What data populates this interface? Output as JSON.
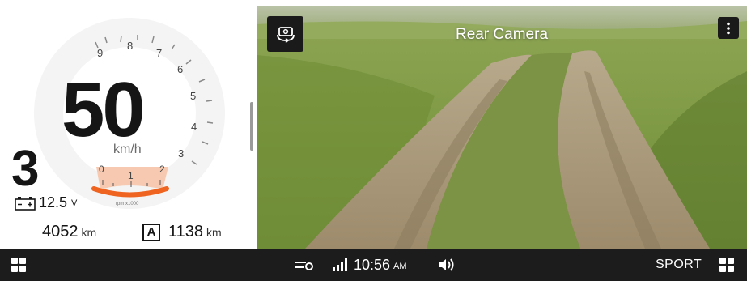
{
  "cluster": {
    "speed": "50",
    "speed_unit": "km/h",
    "gear": "3",
    "battery_voltage": "12.5",
    "battery_unit": "V",
    "odometer_value": "4052",
    "odometer_unit": "km",
    "trip_label": "A",
    "trip_value": "1138",
    "trip_unit": "km",
    "speed_dial_labels": [
      "9",
      "8",
      "7",
      "6",
      "5",
      "4",
      "3"
    ],
    "rpm_labels": [
      "0",
      "1",
      "2"
    ],
    "rpm_caption": "rpm x1000",
    "rpm_level": 2,
    "rpm_max": 2
  },
  "camera": {
    "title": "Rear Camera",
    "switch_icon": "camera-switch-icon",
    "menu_icon": "more-vertical-icon"
  },
  "bottom_bar": {
    "time": "10:56",
    "ampm": "AM",
    "mode": "SPORT",
    "left_icon": "apps-grid-icon",
    "right_icon": "apps-grid-icon",
    "status_icons": [
      "key-icon",
      "signal-icon",
      "volume-icon"
    ]
  },
  "colors": {
    "rpm_fill": "#f6c9b0",
    "rpm_arc": "#ee6420",
    "bar_bg": "#1c1c1c"
  }
}
